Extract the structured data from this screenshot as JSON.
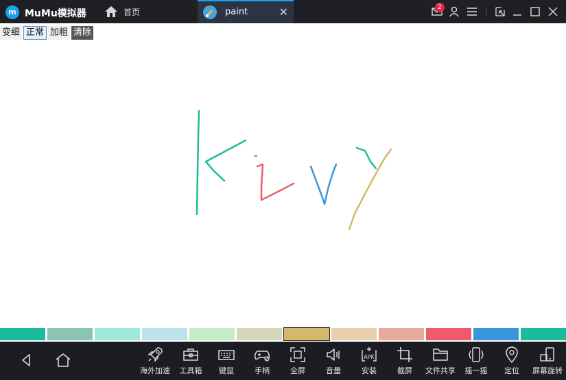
{
  "app": {
    "title": "MuMu模拟器",
    "logo_text": "m"
  },
  "tabs": [
    {
      "label": "首页",
      "icon": "home-icon"
    },
    {
      "label": "paint",
      "icon": "paint-app-icon",
      "active": true
    }
  ],
  "window": {
    "notification_count": "2"
  },
  "buttons": [
    {
      "label": "变细",
      "state": "normal"
    },
    {
      "label": "正常",
      "state": "selected"
    },
    {
      "label": "加粗",
      "state": "normal"
    },
    {
      "label": "清除",
      "state": "dark"
    }
  ],
  "palette": {
    "colors": [
      "#1abc9c",
      "#8cc4b4",
      "#9fe8dc",
      "#bde3ea",
      "#c6ecc6",
      "#d7d6b8",
      "#d5b86a",
      "#e8ceaa",
      "#e9aa9c",
      "#ee5c6c",
      "#3996dc",
      "#1abc9c"
    ],
    "selected_index": 6
  },
  "drawing": {
    "strokes": [
      {
        "color": "#1abc9c"
      },
      {
        "color": "#1abc9c"
      },
      {
        "color": "#ee5c6c"
      },
      {
        "color": "#3996dc"
      },
      {
        "color": "#1abc9c"
      },
      {
        "color": "#d5b86a"
      }
    ]
  },
  "toolbar": {
    "items": [
      {
        "label": "海外加速",
        "icon": "rocket-icon"
      },
      {
        "label": "工具箱",
        "icon": "toolbox-icon"
      },
      {
        "label": "键鼠",
        "icon": "keyboard-icon"
      },
      {
        "label": "手柄",
        "icon": "gamepad-icon"
      },
      {
        "label": "全屏",
        "icon": "fullscreen-icon"
      },
      {
        "label": "音量",
        "icon": "volume-icon"
      },
      {
        "label": "安装",
        "icon": "apk-install-icon"
      },
      {
        "label": "截屏",
        "icon": "crop-icon"
      },
      {
        "label": "文件共享",
        "icon": "folder-icon"
      },
      {
        "label": "摇一摇",
        "icon": "shake-icon"
      },
      {
        "label": "定位",
        "icon": "location-icon"
      },
      {
        "label": "屏幕旋转",
        "icon": "rotate-icon"
      }
    ]
  }
}
